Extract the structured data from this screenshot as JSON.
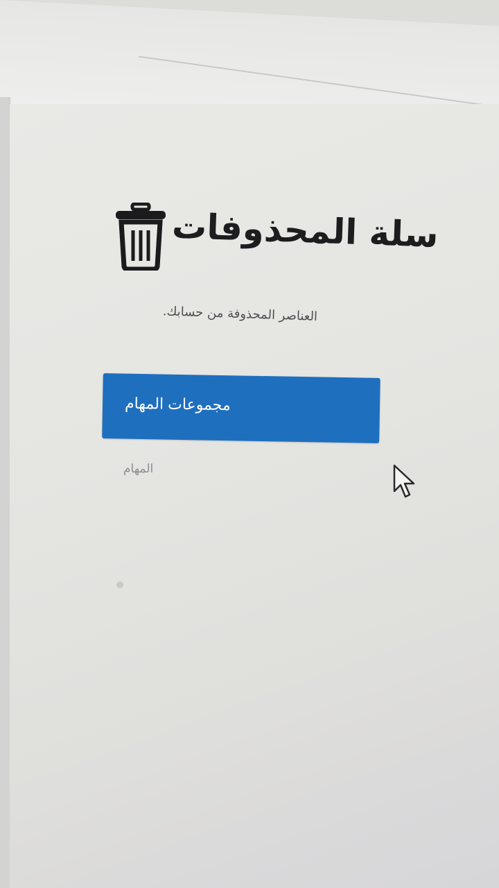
{
  "trash": {
    "title": "سلة المحذوفات",
    "description": "العناصر المحذوفة من حسابك.",
    "primary_button_label": "مجموعات المهام",
    "secondary_link_label": "المهام",
    "icon": "trash-icon"
  },
  "colors": {
    "accent": "#1f6fbf",
    "title_text": "#1d1d1f",
    "muted_text": "#8d8d90"
  }
}
